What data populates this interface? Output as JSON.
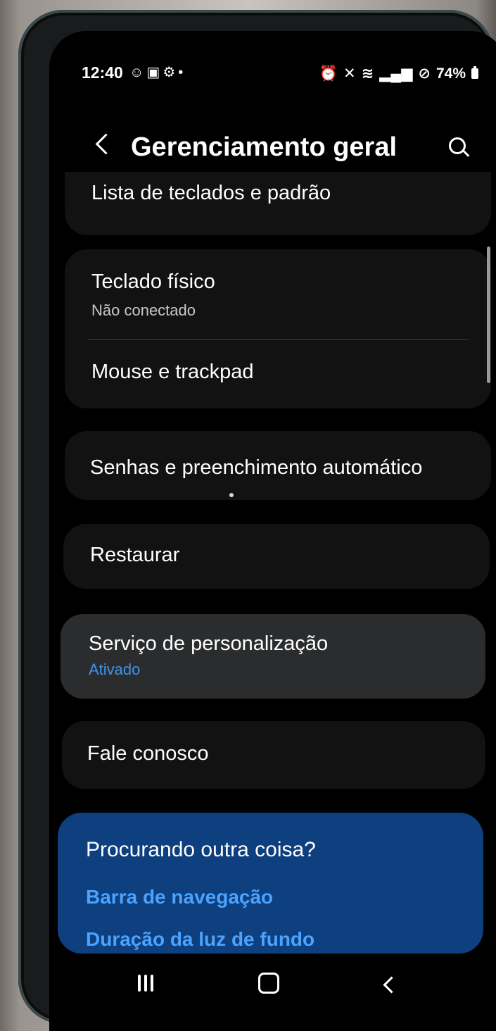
{
  "status_bar": {
    "time": "12:40",
    "left_icons": [
      "chat-icon",
      "mail-icon",
      "gear-icon",
      "dot-icon"
    ],
    "right_icons": [
      "alarm-icon",
      "mute-icon",
      "wifi-icon",
      "volte-icon",
      "signal-icon",
      "dnd-icon"
    ],
    "battery": "74%"
  },
  "app_bar": {
    "title": "Gerenciamento geral"
  },
  "items": [
    {
      "title": "Lista de teclados e padrão"
    },
    {
      "title": "Teclado físico",
      "subtitle": "Não conectado"
    },
    {
      "title": "Mouse e trackpad"
    },
    {
      "title": "Senhas e preenchimento automático"
    },
    {
      "title": "Restaurar"
    },
    {
      "title": "Serviço de personalização",
      "subtitle": "Ativado"
    },
    {
      "title": "Fale conosco"
    }
  ],
  "suggestions": {
    "title": "Procurando outra coisa?",
    "links": [
      "Barra de navegação",
      "Duração da luz de fundo"
    ]
  },
  "colors": {
    "accent": "#3f94ea",
    "suggest_card": "#0e3f7e",
    "card": "#121212",
    "selected_card": "#2a2c2e"
  }
}
